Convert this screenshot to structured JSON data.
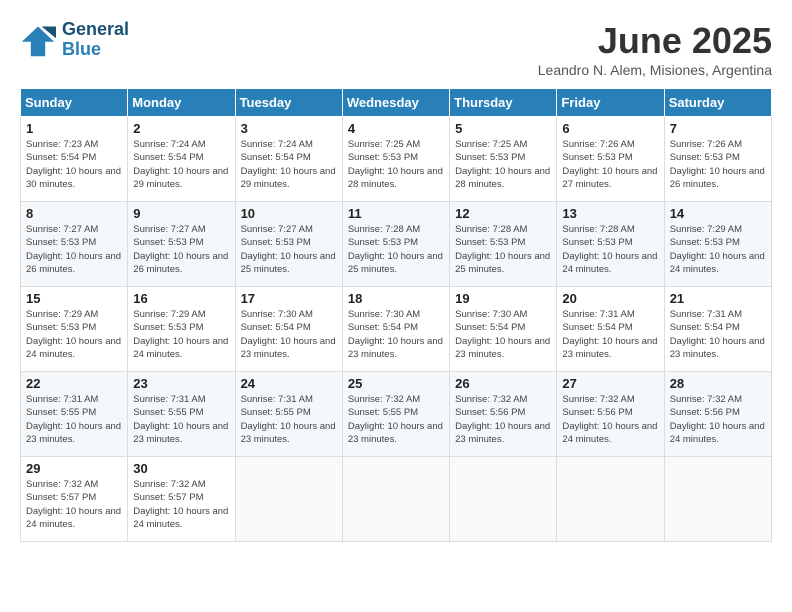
{
  "logo": {
    "line1": "General",
    "line2": "Blue"
  },
  "title": "June 2025",
  "subtitle": "Leandro N. Alem, Misiones, Argentina",
  "weekdays": [
    "Sunday",
    "Monday",
    "Tuesday",
    "Wednesday",
    "Thursday",
    "Friday",
    "Saturday"
  ],
  "weeks": [
    [
      {
        "day": "1",
        "sunrise": "7:23 AM",
        "sunset": "5:54 PM",
        "daylight": "10 hours and 30 minutes."
      },
      {
        "day": "2",
        "sunrise": "7:24 AM",
        "sunset": "5:54 PM",
        "daylight": "10 hours and 29 minutes."
      },
      {
        "day": "3",
        "sunrise": "7:24 AM",
        "sunset": "5:54 PM",
        "daylight": "10 hours and 29 minutes."
      },
      {
        "day": "4",
        "sunrise": "7:25 AM",
        "sunset": "5:53 PM",
        "daylight": "10 hours and 28 minutes."
      },
      {
        "day": "5",
        "sunrise": "7:25 AM",
        "sunset": "5:53 PM",
        "daylight": "10 hours and 28 minutes."
      },
      {
        "day": "6",
        "sunrise": "7:26 AM",
        "sunset": "5:53 PM",
        "daylight": "10 hours and 27 minutes."
      },
      {
        "day": "7",
        "sunrise": "7:26 AM",
        "sunset": "5:53 PM",
        "daylight": "10 hours and 26 minutes."
      }
    ],
    [
      {
        "day": "8",
        "sunrise": "7:27 AM",
        "sunset": "5:53 PM",
        "daylight": "10 hours and 26 minutes."
      },
      {
        "day": "9",
        "sunrise": "7:27 AM",
        "sunset": "5:53 PM",
        "daylight": "10 hours and 26 minutes."
      },
      {
        "day": "10",
        "sunrise": "7:27 AM",
        "sunset": "5:53 PM",
        "daylight": "10 hours and 25 minutes."
      },
      {
        "day": "11",
        "sunrise": "7:28 AM",
        "sunset": "5:53 PM",
        "daylight": "10 hours and 25 minutes."
      },
      {
        "day": "12",
        "sunrise": "7:28 AM",
        "sunset": "5:53 PM",
        "daylight": "10 hours and 25 minutes."
      },
      {
        "day": "13",
        "sunrise": "7:28 AM",
        "sunset": "5:53 PM",
        "daylight": "10 hours and 24 minutes."
      },
      {
        "day": "14",
        "sunrise": "7:29 AM",
        "sunset": "5:53 PM",
        "daylight": "10 hours and 24 minutes."
      }
    ],
    [
      {
        "day": "15",
        "sunrise": "7:29 AM",
        "sunset": "5:53 PM",
        "daylight": "10 hours and 24 minutes."
      },
      {
        "day": "16",
        "sunrise": "7:29 AM",
        "sunset": "5:53 PM",
        "daylight": "10 hours and 24 minutes."
      },
      {
        "day": "17",
        "sunrise": "7:30 AM",
        "sunset": "5:54 PM",
        "daylight": "10 hours and 23 minutes."
      },
      {
        "day": "18",
        "sunrise": "7:30 AM",
        "sunset": "5:54 PM",
        "daylight": "10 hours and 23 minutes."
      },
      {
        "day": "19",
        "sunrise": "7:30 AM",
        "sunset": "5:54 PM",
        "daylight": "10 hours and 23 minutes."
      },
      {
        "day": "20",
        "sunrise": "7:31 AM",
        "sunset": "5:54 PM",
        "daylight": "10 hours and 23 minutes."
      },
      {
        "day": "21",
        "sunrise": "7:31 AM",
        "sunset": "5:54 PM",
        "daylight": "10 hours and 23 minutes."
      }
    ],
    [
      {
        "day": "22",
        "sunrise": "7:31 AM",
        "sunset": "5:55 PM",
        "daylight": "10 hours and 23 minutes."
      },
      {
        "day": "23",
        "sunrise": "7:31 AM",
        "sunset": "5:55 PM",
        "daylight": "10 hours and 23 minutes."
      },
      {
        "day": "24",
        "sunrise": "7:31 AM",
        "sunset": "5:55 PM",
        "daylight": "10 hours and 23 minutes."
      },
      {
        "day": "25",
        "sunrise": "7:32 AM",
        "sunset": "5:55 PM",
        "daylight": "10 hours and 23 minutes."
      },
      {
        "day": "26",
        "sunrise": "7:32 AM",
        "sunset": "5:56 PM",
        "daylight": "10 hours and 23 minutes."
      },
      {
        "day": "27",
        "sunrise": "7:32 AM",
        "sunset": "5:56 PM",
        "daylight": "10 hours and 24 minutes."
      },
      {
        "day": "28",
        "sunrise": "7:32 AM",
        "sunset": "5:56 PM",
        "daylight": "10 hours and 24 minutes."
      }
    ],
    [
      {
        "day": "29",
        "sunrise": "7:32 AM",
        "sunset": "5:57 PM",
        "daylight": "10 hours and 24 minutes."
      },
      {
        "day": "30",
        "sunrise": "7:32 AM",
        "sunset": "5:57 PM",
        "daylight": "10 hours and 24 minutes."
      },
      null,
      null,
      null,
      null,
      null
    ]
  ],
  "labels": {
    "sunrise": "Sunrise:",
    "sunset": "Sunset:",
    "daylight": "Daylight:"
  },
  "colors": {
    "header_bg": "#2980b9",
    "accent": "#1a5276"
  }
}
